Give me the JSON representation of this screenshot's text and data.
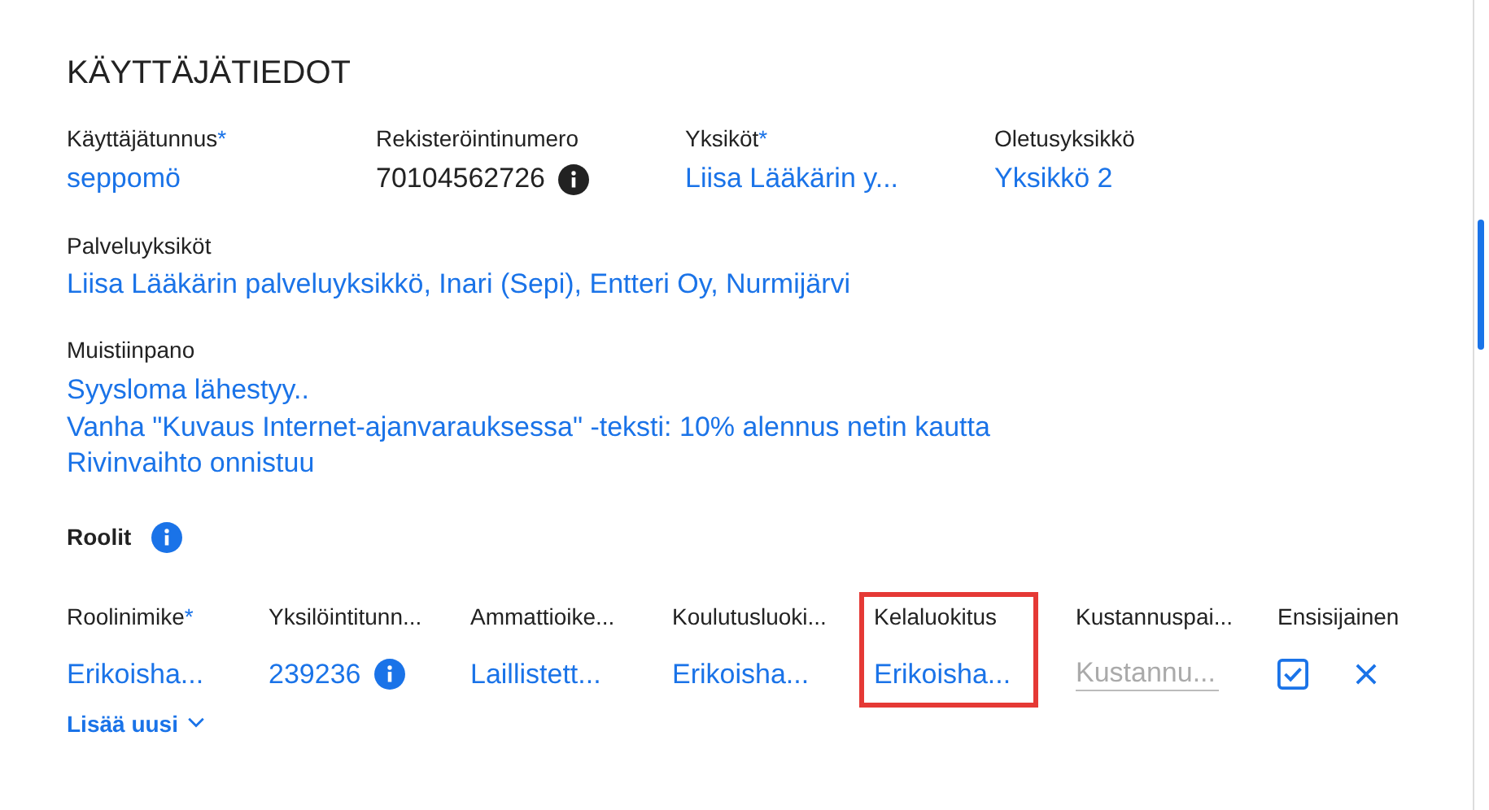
{
  "title": "KÄYTTÄJÄTIEDOT",
  "fields": [
    {
      "label": "Käyttäjätunnus",
      "mark": "*",
      "value": "seppomö",
      "info": false
    },
    {
      "label": "Rekisteröintinumero",
      "value": "70104562726",
      "info": true,
      "kind": "plain"
    },
    {
      "label": "Yksiköt",
      "mark": "*",
      "value": "Liisa Lääkärin y...",
      "info": false
    },
    {
      "label": "Oletusyksikkö",
      "value": "Yksikkö 2",
      "info": false
    }
  ],
  "service_units": {
    "label": "Palveluyksiköt",
    "value": "Liisa Lääkärin palveluyksikkö, Inari (Sepi), Entteri Oy, Nurmijärvi"
  },
  "note": {
    "label": "Muistiinpano",
    "lines": [
      "Syysloma lähestyy..",
      "Vanha \"Kuvaus Internet-ajanvarauksessa\" -teksti: 10% alennus netin kautta",
      "Rivinvaihto onnistuu"
    ]
  },
  "roles": {
    "title": "Roolit",
    "columns": [
      {
        "header": "Roolinimike",
        "mark": "*",
        "highlighted": false
      },
      {
        "header": "Yksilöintitunn...",
        "highlighted": false
      },
      {
        "header": "Ammattioike...",
        "highlighted": false
      },
      {
        "header": "Koulutusluoki...",
        "highlighted": false
      },
      {
        "header": "Kelaluokitus",
        "highlighted": true
      },
      {
        "header": "Kustannuspai...",
        "highlighted": false
      },
      {
        "header": "Ensisijainen",
        "highlighted": false
      },
      {
        "highlighted": false
      }
    ],
    "cells": [
      {
        "kind": "link",
        "text": "Erikoisha..."
      },
      {
        "kind": "info",
        "text": "239236"
      },
      {
        "kind": "link",
        "text": "Laillistett..."
      },
      {
        "kind": "link",
        "text": "Erikoisha..."
      },
      {
        "kind": "link",
        "text": "Erikoisha..."
      },
      {
        "kind": "placeholder",
        "placeholder": "Kustannu..."
      },
      {
        "kind": "checkbox",
        "checked": true
      },
      {
        "kind": "remove"
      }
    ],
    "add_button": "Lisää uusi"
  }
}
